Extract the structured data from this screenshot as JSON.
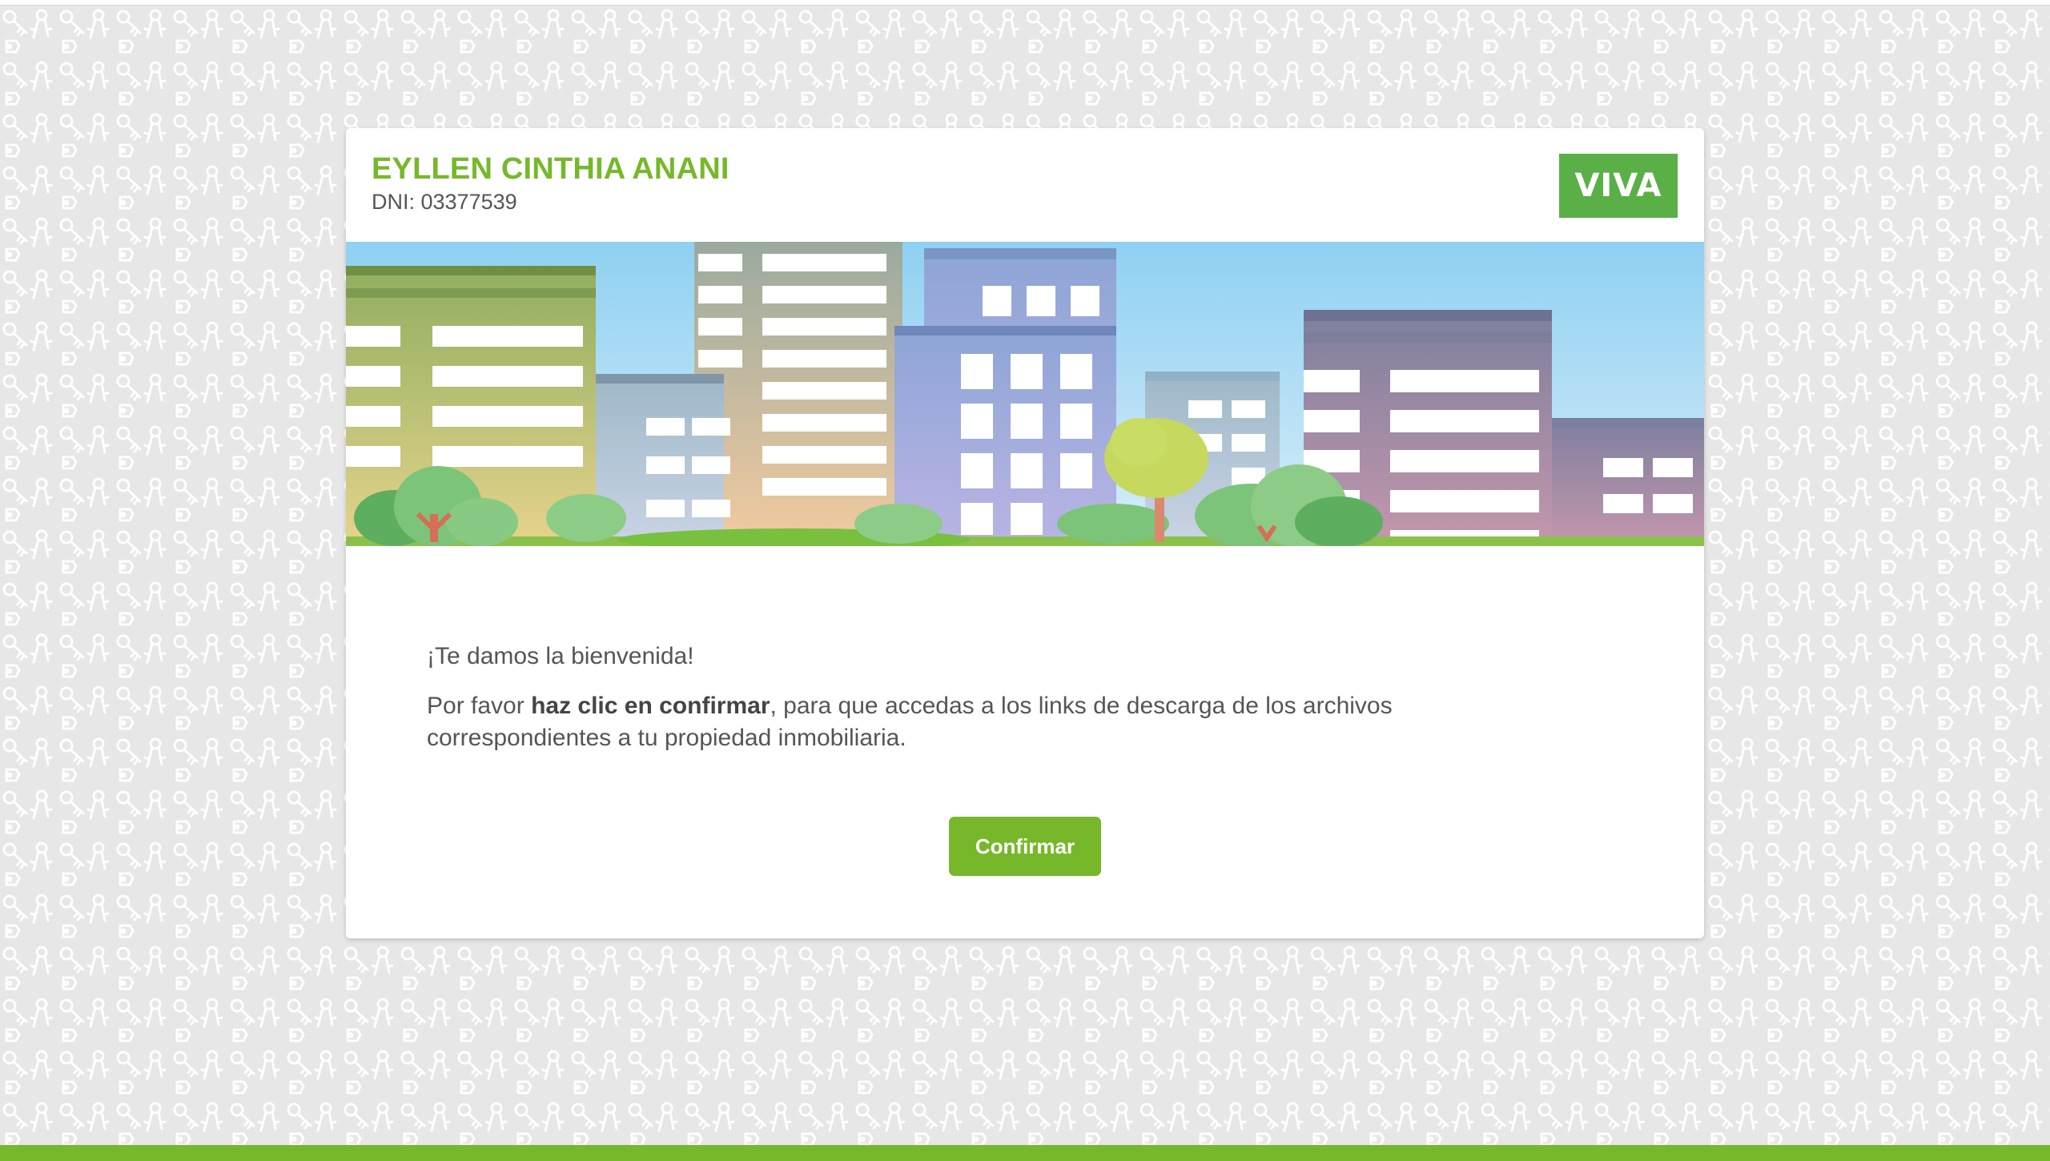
{
  "owner": {
    "name": "EYLLEN CINTHIA ANANI",
    "dni": "DNI: 03377539"
  },
  "brand": {
    "logo_text": "VIVA"
  },
  "content": {
    "welcome": "¡Te damos la bienvenida!",
    "message_prefix": "Por favor ",
    "message_bold": "haz clic en confirmar",
    "message_suffix": ", para que accedas a los links de descarga de los archivos correspondientes a tu propiedad inmobiliaria."
  },
  "actions": {
    "confirm_label": "Confirmar"
  },
  "background": {
    "pattern_icon": "keys-icon"
  },
  "colors": {
    "brand_green": "#76b82a",
    "logo_green": "#5ab046",
    "background": "#e7e7e7",
    "text_gray": "#555555"
  }
}
